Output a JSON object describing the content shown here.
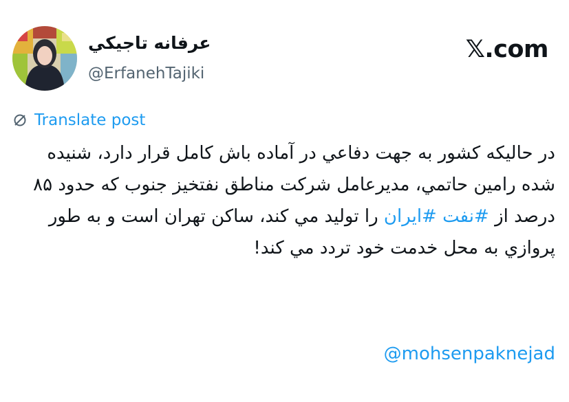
{
  "author": {
    "display_name": "عرفانه تاجيكي",
    "handle": "@ErfanehTajiki"
  },
  "site_logo": "𝕏.com",
  "translate": {
    "label": "Translate post",
    "icon": "no-translate-icon"
  },
  "post": {
    "text_before": "در حالیکه کشور به جهت دفاعي در آماده باش كامل قرار دارد، شنيده شده رامين حاتمي، مديرعامل شركت مناطق نفتخيز جنوب كه حدود ۸۵ درصد از ",
    "hashtag_1": "#نفت",
    "hashtag_2": "#ایران",
    "text_after": " را توليد مي كند، ساكن تهران است و به طور پروازي به محل خدمت خود تردد مي كند!",
    "mention": "@mohsenpaknejad"
  },
  "colors": {
    "accent": "#1d9bf0",
    "text": "#0f1419",
    "muted": "#536471"
  }
}
